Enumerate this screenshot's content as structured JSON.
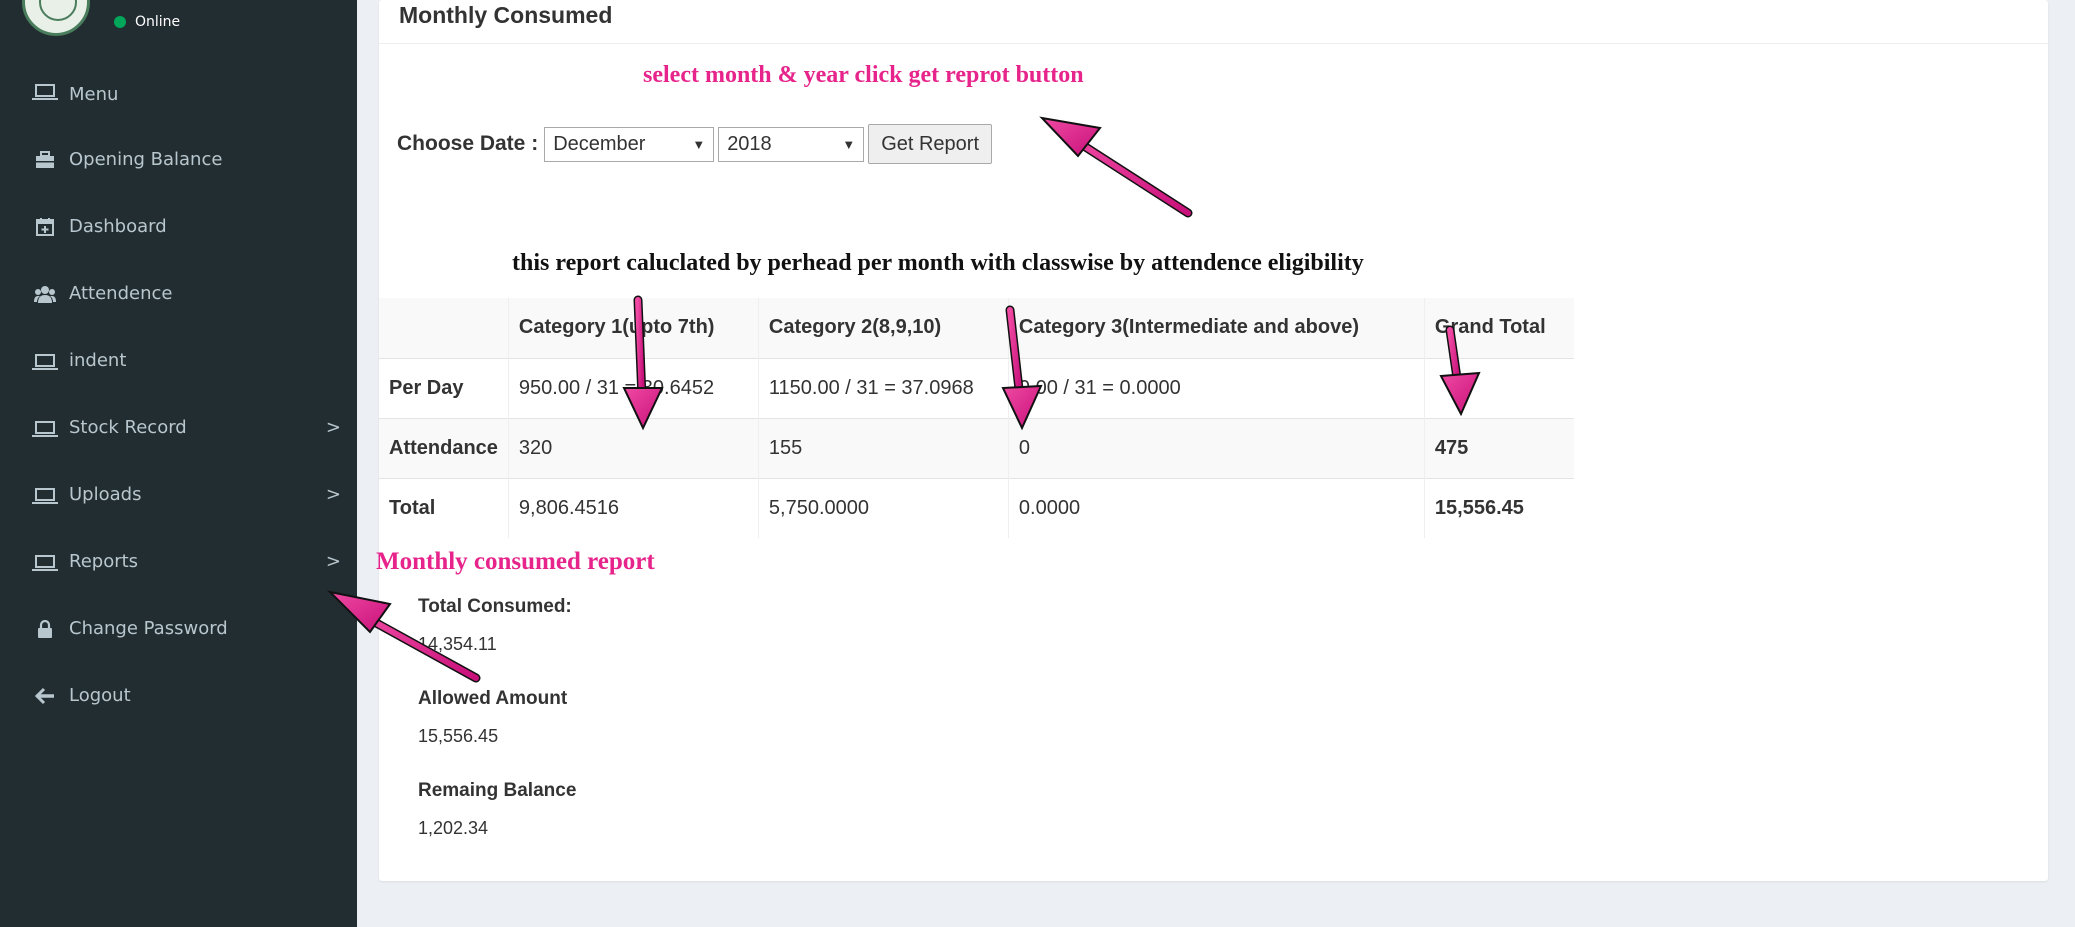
{
  "sidebar": {
    "status": "Online",
    "items": [
      {
        "label": "Menu",
        "icon": "monitor-icon"
      },
      {
        "label": "Opening Balance",
        "icon": "briefcase-icon"
      },
      {
        "label": "Dashboard",
        "icon": "calendar-plus-icon"
      },
      {
        "label": "Attendence",
        "icon": "users-icon"
      },
      {
        "label": "indent",
        "icon": "monitor-icon"
      },
      {
        "label": "Stock Record",
        "icon": "monitor-icon",
        "chevron": ">"
      },
      {
        "label": "Uploads",
        "icon": "monitor-icon",
        "chevron": ">"
      },
      {
        "label": "Reports",
        "icon": "monitor-icon",
        "chevron": ">"
      },
      {
        "label": "Change Password",
        "icon": "lock-icon"
      },
      {
        "label": "Logout",
        "icon": "arrow-left-icon"
      }
    ]
  },
  "box": {
    "title": "Monthly Consumed"
  },
  "annotations": {
    "select_hint": "select month & year click get reprot button",
    "report_note": "this report caluclated by perhead per month with classwise by attendence eligibility",
    "monthly_report": "Monthly consumed report"
  },
  "filter": {
    "label": "Choose Date :",
    "month": "December",
    "year": "2018",
    "button": "Get Report"
  },
  "table": {
    "headers": [
      "",
      "Category 1(upto 7th)",
      "Category 2(8,9,10)",
      "Category 3(Intermediate and above)",
      "Grand Total"
    ],
    "rows": [
      {
        "label": "Per Day",
        "cells": [
          "950.00 / 31 = 30.6452",
          "1150.00 / 31 = 37.0968",
          "0.00 / 31 = 0.0000",
          ""
        ]
      },
      {
        "label": "Attendance",
        "cells": [
          "320",
          "155",
          "0",
          "475"
        ]
      },
      {
        "label": "Total",
        "cells": [
          "9,806.4516",
          "5,750.0000",
          "0.0000",
          "15,556.45"
        ]
      }
    ]
  },
  "summary": {
    "total_consumed_label": "Total Consumed:",
    "total_consumed_value": "14,354.11",
    "allowed_label": "Allowed Amount",
    "allowed_value": "15,556.45",
    "remaining_label": "Remaing Balance",
    "remaining_value": "1,202.34"
  },
  "colors": {
    "sidebar_bg": "#222d32",
    "sidebar_text": "#b8c7ce",
    "page_bg": "#ecf0f5",
    "annotation_pink": "#e6248b",
    "online_dot": "#00a65a"
  }
}
